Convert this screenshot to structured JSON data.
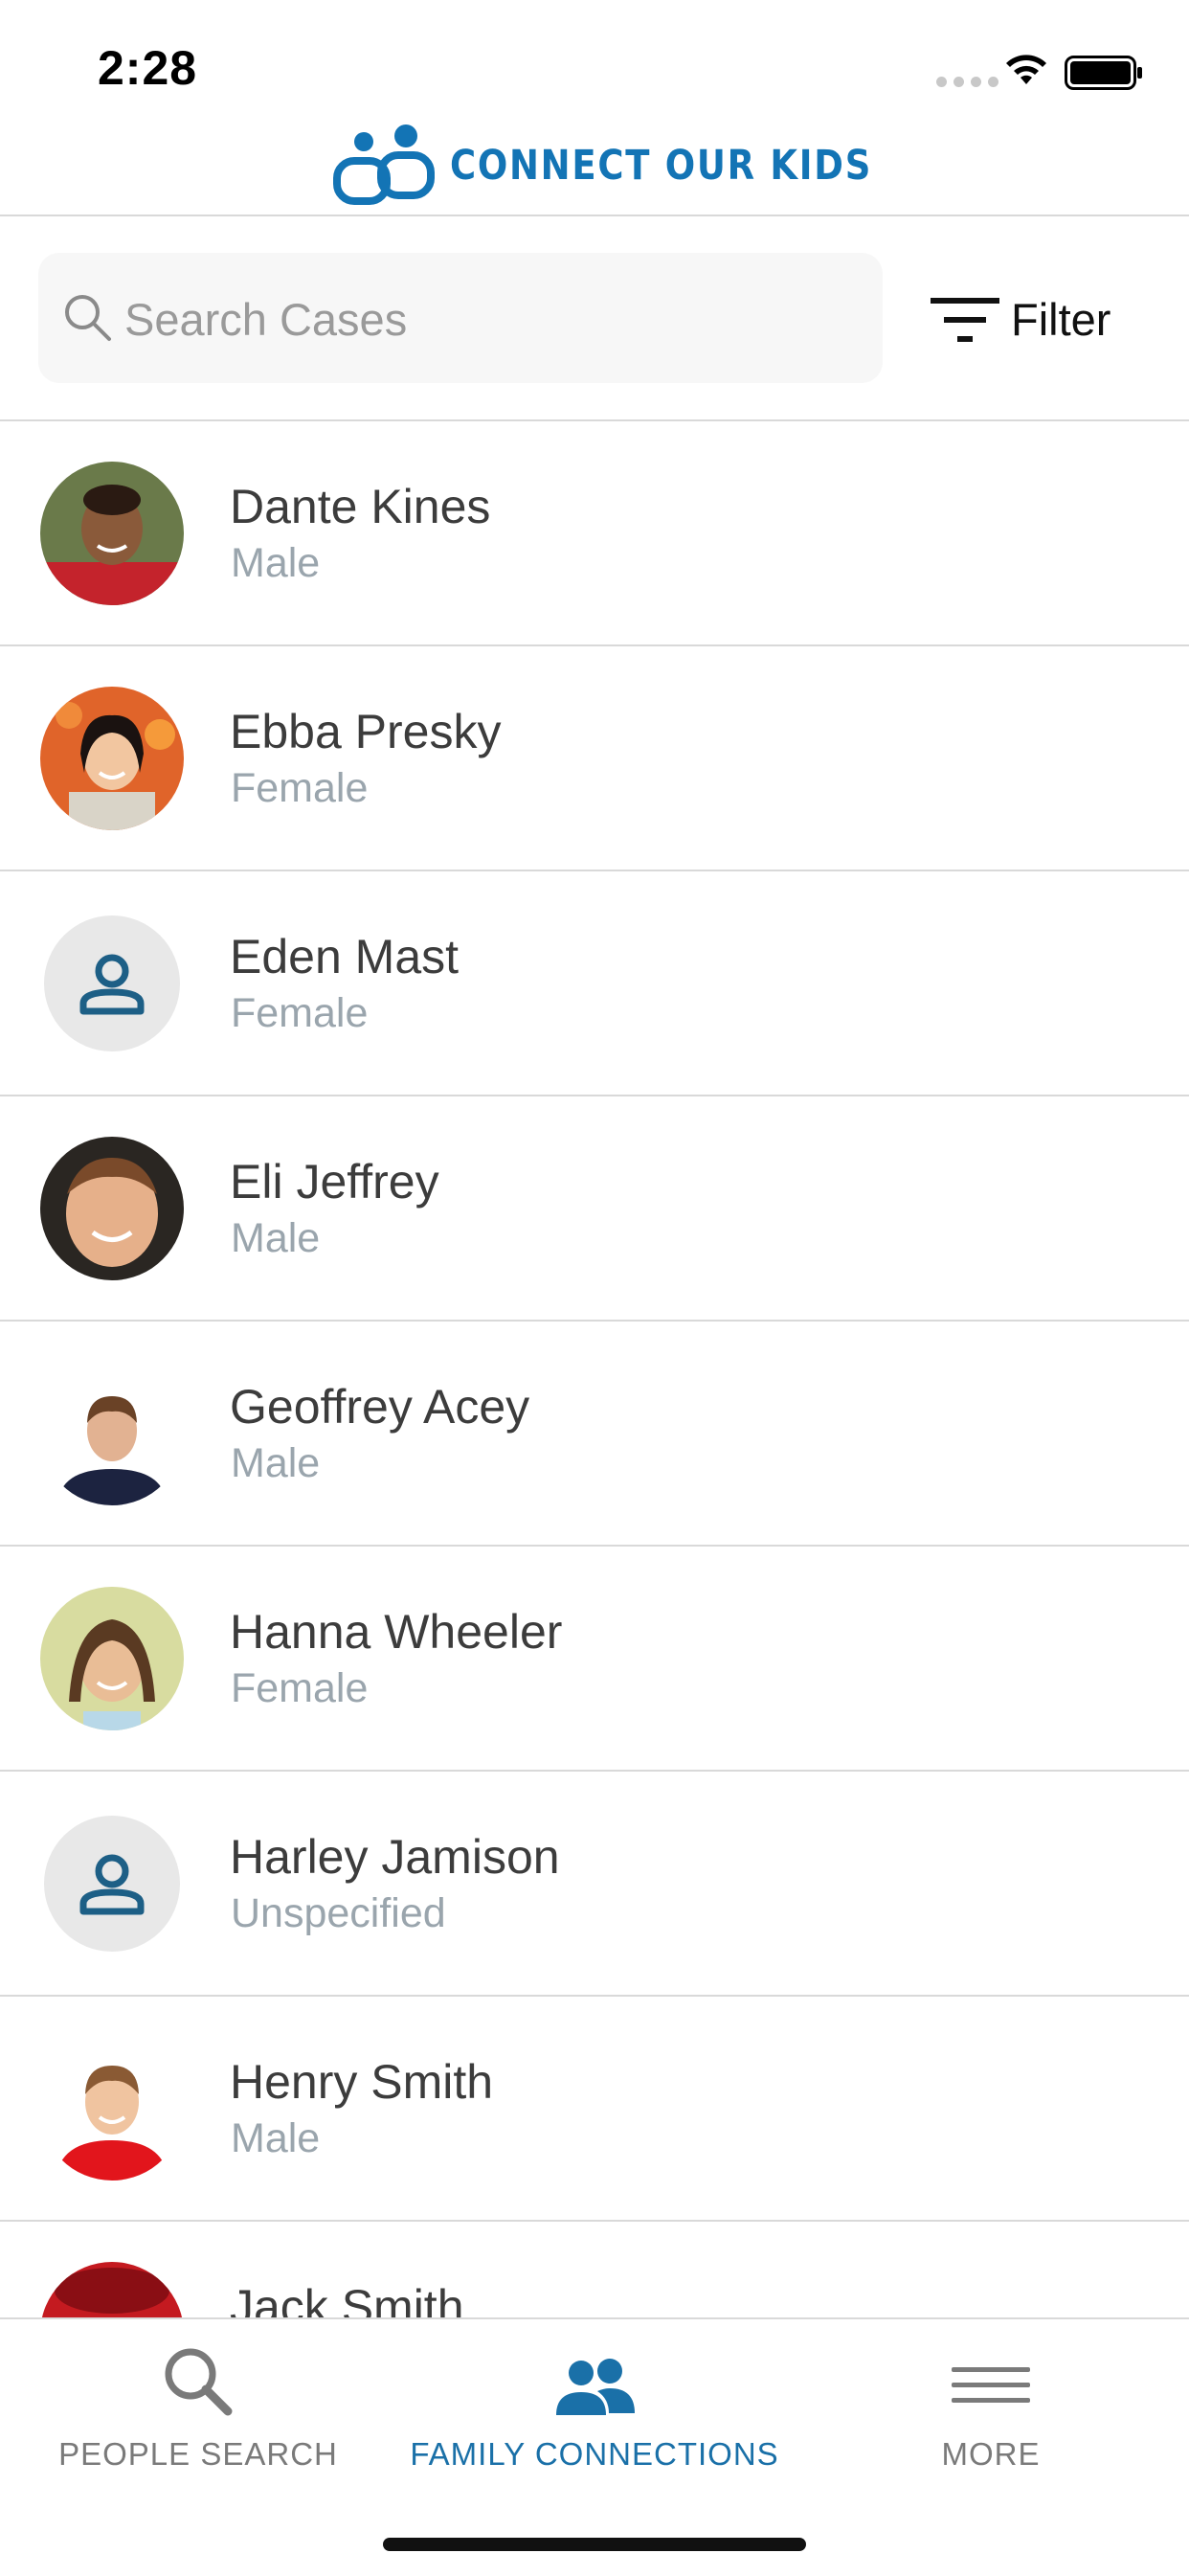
{
  "status_bar": {
    "time": "2:28"
  },
  "header": {
    "logo_text": "CONNECT OUR KIDS",
    "brand_color": "#1374b5"
  },
  "search": {
    "placeholder": "Search Cases",
    "value": "",
    "filter_label": "Filter"
  },
  "cases": [
    {
      "name": "Dante Kines",
      "gender": "Male",
      "avatar": "photo"
    },
    {
      "name": "Ebba Presky",
      "gender": "Female",
      "avatar": "photo"
    },
    {
      "name": "Eden Mast",
      "gender": "Female",
      "avatar": "person-placeholder-icon"
    },
    {
      "name": "Eli Jeffrey",
      "gender": "Male",
      "avatar": "photo"
    },
    {
      "name": "Geoffrey Acey",
      "gender": "Male",
      "avatar": "photo"
    },
    {
      "name": "Hanna Wheeler",
      "gender": "Female",
      "avatar": "photo"
    },
    {
      "name": "Harley Jamison",
      "gender": "Unspecified",
      "avatar": "person-placeholder-icon"
    },
    {
      "name": "Henry Smith",
      "gender": "Male",
      "avatar": "photo"
    },
    {
      "name": "Jack Smith",
      "gender": "",
      "avatar": "photo"
    }
  ],
  "tabs": [
    {
      "label": "PEOPLE SEARCH",
      "icon": "search-icon",
      "active": false
    },
    {
      "label": "FAMILY CONNECTIONS",
      "icon": "people-icon",
      "active": true
    },
    {
      "label": "MORE",
      "icon": "menu-icon",
      "active": false
    }
  ],
  "colors": {
    "accent": "#1a70a8",
    "inactive_tab": "#7a7a7a",
    "secondary_text": "#9aa5ad",
    "divider": "#d9d9d9"
  }
}
